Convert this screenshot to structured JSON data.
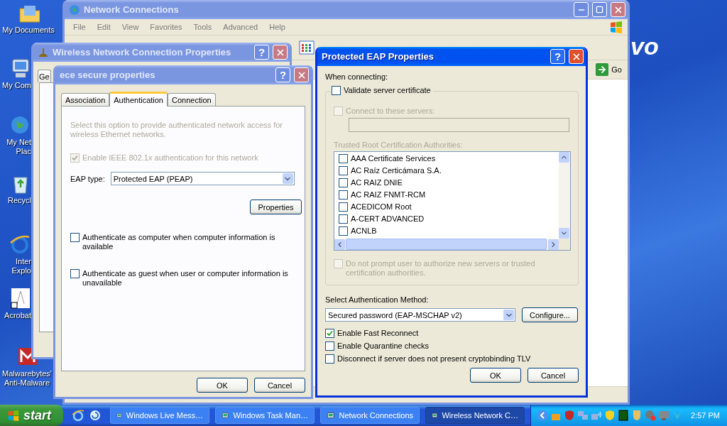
{
  "desktop": {
    "icons": [
      {
        "label": "My Documents",
        "kind": "folder"
      },
      {
        "label": "My Com",
        "kind": "computer"
      },
      {
        "label": "My Net\nPlac",
        "kind": "network"
      },
      {
        "label": "Recycl",
        "kind": "recycle"
      },
      {
        "label": "Inter\nExplo",
        "kind": "browser"
      },
      {
        "label": "Acrobat",
        "kind": "acrobat"
      },
      {
        "label": "Malwarebytes'\nAnti-Malware",
        "kind": "malware"
      }
    ],
    "wallpaper_logo": "vo"
  },
  "network_window": {
    "title": "Network Connections",
    "active": false,
    "menu": [
      "File",
      "Edit",
      "View",
      "Favorites",
      "Tools",
      "Advanced",
      "Help"
    ],
    "go_button": "Go"
  },
  "wireless_window": {
    "title": "Wireless Network Connection Properties",
    "active": false,
    "help_button": "?",
    "tabs": [
      {
        "label": "Ge",
        "selected": false
      }
    ]
  },
  "ece_window": {
    "title": "ece secure properties",
    "active": false,
    "help_button": "?",
    "tabs": [
      {
        "label": "Association",
        "selected": false
      },
      {
        "label": "Authentication",
        "selected": true
      },
      {
        "label": "Connection",
        "selected": false
      }
    ],
    "intro": "Select this option to provide authenticated network access for wireless Ethernet networks.",
    "enable_8021x": {
      "label": "Enable IEEE 802.1x authentication for this network",
      "checked": true,
      "disabled": true
    },
    "eap_type_label": "EAP type:",
    "eap_type_value": "Protected EAP (PEAP)",
    "properties_button": "Properties",
    "options": [
      {
        "label": "Authenticate as computer when computer information is available",
        "checked": false
      },
      {
        "label": "Authenticate as guest when user or computer information is unavailable",
        "checked": false
      }
    ],
    "buttons": [
      "OK",
      "Cancel"
    ]
  },
  "peap_window": {
    "title": "Protected EAP Properties",
    "active": true,
    "help_button": "?",
    "when_connecting": "When connecting:",
    "validate": {
      "label": "Validate server certificate",
      "checked": false
    },
    "connect_servers": {
      "label": "Connect to these servers:",
      "checked": false,
      "disabled": true
    },
    "trusted_label": "Trusted Root Certification Authorities:",
    "authorities": [
      {
        "label": "AAA Certificate Services",
        "checked": false
      },
      {
        "label": "AC Raíz Certicámara S.A.",
        "checked": false
      },
      {
        "label": "AC RAIZ DNIE",
        "checked": false
      },
      {
        "label": "AC RAIZ FNMT-RCM",
        "checked": false
      },
      {
        "label": "ACEDICOM Root",
        "checked": false
      },
      {
        "label": "A-CERT ADVANCED",
        "checked": false
      },
      {
        "label": "ACNLB",
        "checked": false
      }
    ],
    "no_prompt": {
      "label": "Do not prompt user to authorize new servers or trusted certification authorities.",
      "checked": false,
      "disabled": true
    },
    "method_label": "Select Authentication Method:",
    "method_value": "Secured password (EAP-MSCHAP v2)",
    "configure_button": "Configure...",
    "options": [
      {
        "label": "Enable Fast Reconnect",
        "checked": true
      },
      {
        "label": "Enable Quarantine checks",
        "checked": false
      },
      {
        "label": "Disconnect if server does not present cryptobinding TLV",
        "checked": false
      }
    ],
    "buttons": [
      "OK",
      "Cancel"
    ]
  },
  "taskbar": {
    "start": "start",
    "tasks": [
      {
        "label": "Windows Live Mess…",
        "selected": false
      },
      {
        "label": "Windows Task Man…",
        "selected": false
      },
      {
        "label": "Network Connections",
        "selected": false
      },
      {
        "label": "Wireless Network C…",
        "selected": true
      }
    ],
    "clock": "2:57 PM"
  }
}
